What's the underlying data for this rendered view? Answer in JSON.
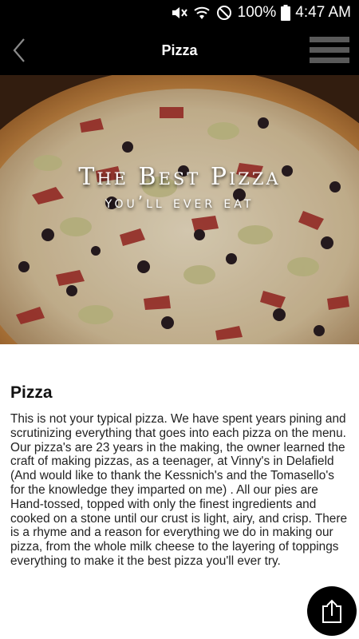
{
  "status_bar": {
    "battery_percent": "100%",
    "time": "4:47 AM",
    "icons": [
      "mute-icon",
      "wifi-icon",
      "do-not-disturb-icon",
      "battery-icon"
    ]
  },
  "app_bar": {
    "title": "Pizza",
    "back_icon": "chevron-left-icon",
    "menu_icon": "hamburger-menu-icon"
  },
  "hero": {
    "title": "The Best Pizza",
    "subtitle": "you’ll ever eat"
  },
  "content": {
    "heading": "Pizza",
    "body": "This is not your typical pizza. We have spent years pining and scrutinizing everything that goes into each pizza on the menu.  Our pizza's are 23 years in the making, the owner learned the craft of making pizzas, as a teenager, at Vinny's in Delafield (And would like to thank the Kessnich's and the Tomasello's for the knowledge they imparted on me) . All our pies are Hand-tossed, topped with only the finest ingredients and cooked on a stone until our crust is light, airy, and crisp.   There is a rhyme and a reason for everything we do in making our pizza, from the whole milk cheese to the layering of toppings everything to make it the best pizza you'll ever try."
  },
  "share_button": {
    "icon": "share-icon"
  },
  "colors": {
    "bar_background": "#000000",
    "menu_icon": "#5a5a5a",
    "text": "#222222"
  }
}
